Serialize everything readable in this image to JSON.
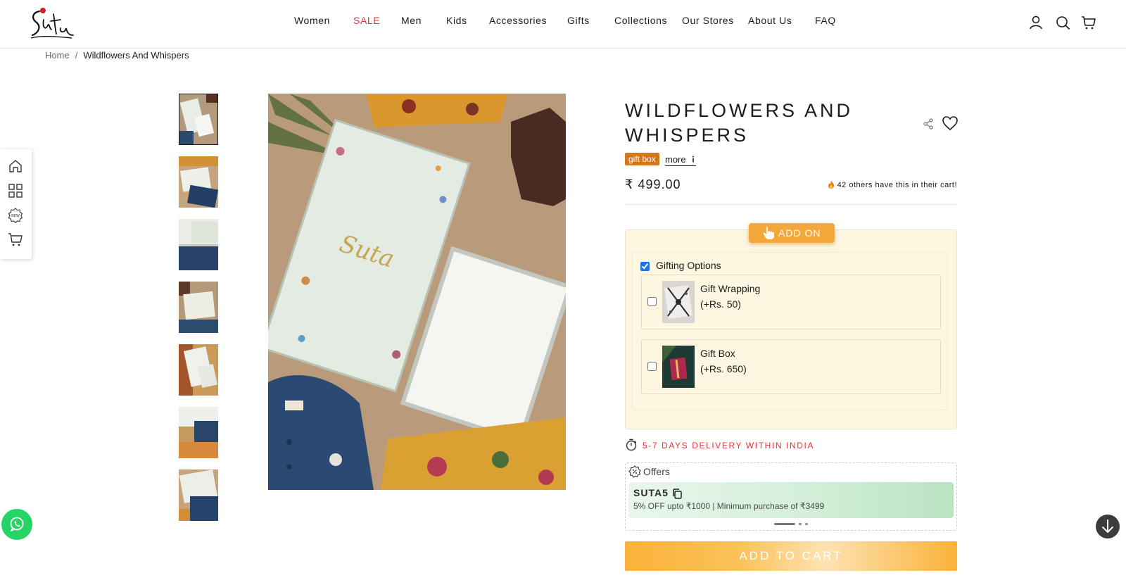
{
  "header": {
    "nav": [
      {
        "label": "Women"
      },
      {
        "label": "SALE"
      },
      {
        "label": "Men"
      },
      {
        "label": "Kids"
      },
      {
        "label": "Accessories"
      },
      {
        "label": "Gifts"
      },
      {
        "label": "Collections"
      },
      {
        "label": "Our Stores"
      },
      {
        "label": "About Us"
      },
      {
        "label": "FAQ"
      }
    ],
    "icons": [
      "account-icon",
      "search-icon",
      "cart-icon"
    ]
  },
  "breadcrumb": {
    "home": "Home",
    "separator": "/",
    "current": "Wildflowers And Whispers"
  },
  "sidebar": {
    "icons": [
      "home-icon",
      "grid-icon",
      "new-icon",
      "cart-icon"
    ]
  },
  "gallery": {
    "thumbnail_count": 7,
    "active_index": 0
  },
  "product": {
    "title": "WILDFLOWERS AND WHISPERS",
    "badge": "gift box",
    "more_label": "more",
    "more_icon": "info-icon",
    "price": "₹ 499.00",
    "cart_note_icon": "fire-icon",
    "cart_note": "42 others have this in their cart!"
  },
  "addon": {
    "button_label": "ADD ON",
    "group_label": "Gifting Options",
    "group_checked": true,
    "options": [
      {
        "name": "Gift Wrapping",
        "price": "(+Rs. 50)",
        "checked": false
      },
      {
        "name": "Gift Box",
        "price": "(+Rs. 650)",
        "checked": false
      }
    ]
  },
  "delivery": {
    "text": "5-7 DAYS DELIVERY WITHIN INDIA"
  },
  "offers": {
    "label": "Offers",
    "code": "SUTA5",
    "description": "5% OFF upto ₹1000 | Minimum purchase of ₹3499",
    "slide_count": 3,
    "active_slide": 0
  },
  "cta": {
    "add_to_cart": "ADD TO CART"
  },
  "colors": {
    "sale": "#e8323c",
    "badge": "#d4771b",
    "addon_bg": "#fdf6e1",
    "addon_button": "#f4a83c",
    "cta": "#fbb23a",
    "offer_card": "#d3efd9",
    "whatsapp": "#25d366"
  }
}
